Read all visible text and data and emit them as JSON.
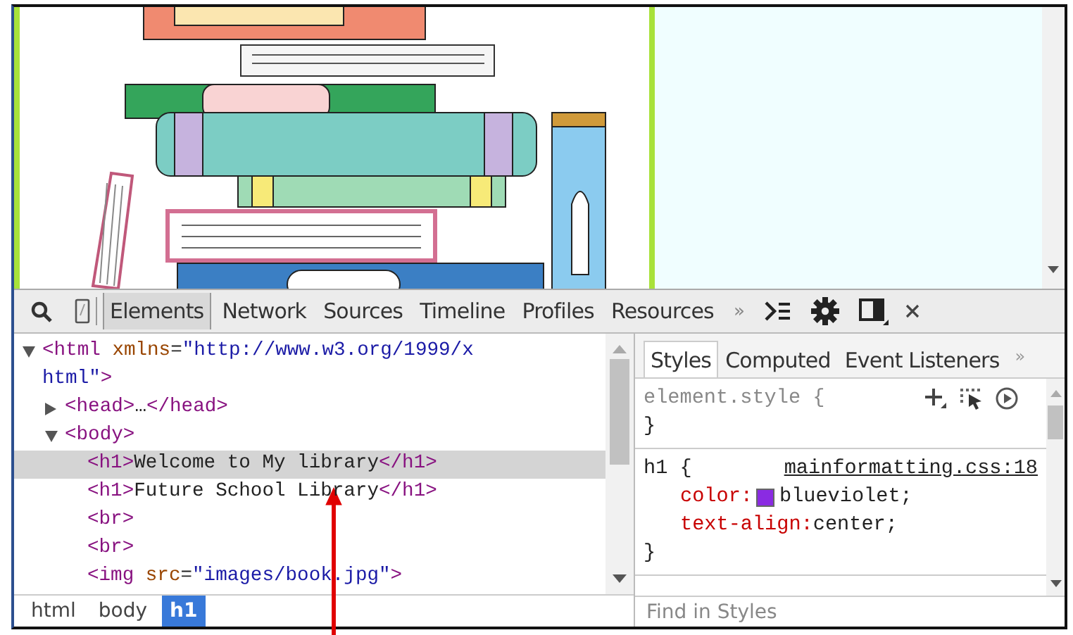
{
  "toolbar": {
    "tabs": [
      {
        "label": "Elements",
        "selected": true
      },
      {
        "label": "Network",
        "selected": false
      },
      {
        "label": "Sources",
        "selected": false
      },
      {
        "label": "Timeline",
        "selected": false
      },
      {
        "label": "Profiles",
        "selected": false
      },
      {
        "label": "Resources",
        "selected": false
      }
    ],
    "more": "»"
  },
  "dom_tree": {
    "nodes": [
      {
        "text": "<html xmlns=\"http://www.w3.org/1999/xhtml\">",
        "expanded": true,
        "selected": false,
        "children": [
          {
            "text": "<head>…</head>",
            "expanded": false,
            "selected": false
          },
          {
            "text": "<body>",
            "expanded": true,
            "selected": false,
            "children": [
              {
                "text": "<h1>Welcome to My library</h1>",
                "selected": true
              },
              {
                "text": "<h1>Future School Library</h1>",
                "selected": false
              },
              {
                "text": "<br>",
                "selected": false
              },
              {
                "text": "<br>",
                "selected": false
              },
              {
                "text": "<img src=\"images/book.jpg\">",
                "selected": false
              }
            ]
          }
        ]
      }
    ]
  },
  "breadcrumbs": [
    {
      "label": "html",
      "selected": false
    },
    {
      "label": "body",
      "selected": false
    },
    {
      "label": "h1",
      "selected": true
    }
  ],
  "styles_panel": {
    "tabs": [
      {
        "label": "Styles",
        "selected": true
      },
      {
        "label": "Computed",
        "selected": false
      },
      {
        "label": "Event Listeners",
        "selected": false
      }
    ],
    "more": "»",
    "rules": [
      {
        "selector": "element.style {",
        "close": "}"
      },
      {
        "selector": "h1 {",
        "source": "mainformatting.css:18",
        "declarations": [
          {
            "property": "color:",
            "value": "blueviolet;",
            "color": "#8a2be2"
          },
          {
            "property": "text-align:",
            "value": "center;"
          }
        ],
        "close": "}"
      }
    ],
    "filter_placeholder": "Find in Styles"
  }
}
